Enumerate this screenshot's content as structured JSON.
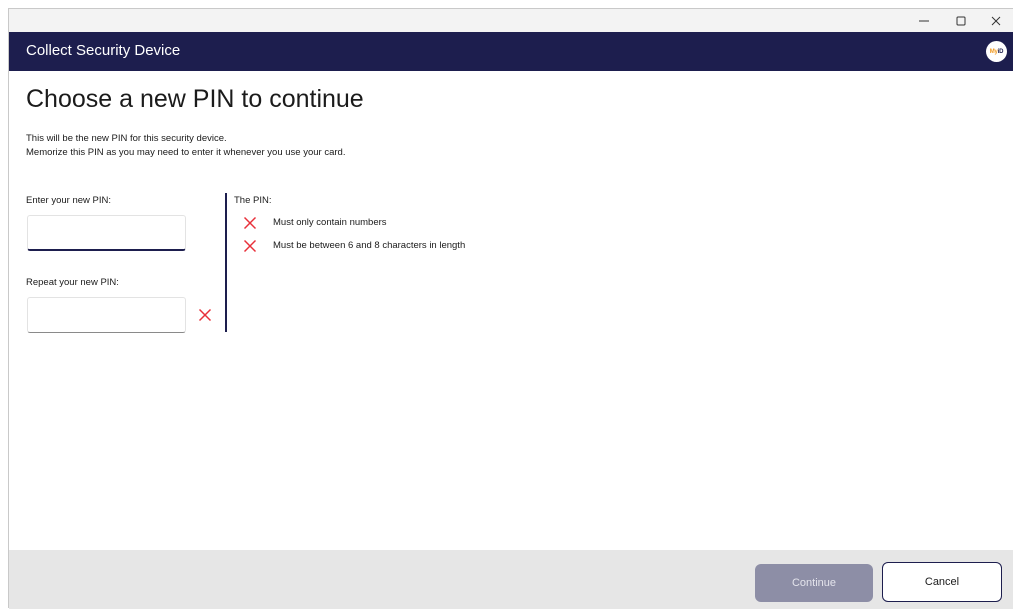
{
  "window": {
    "controls": {
      "minimize": "–",
      "maximize": "☐",
      "close": "✕"
    }
  },
  "header": {
    "title": "Collect Security Device",
    "logo_text_my": "My",
    "logo_text_id": "iD"
  },
  "page": {
    "title": "Choose a new PIN to continue",
    "description_line1": "This will be the new PIN for this security device.",
    "description_line2": "Memorize this PIN as you may need to enter it whenever you use your card."
  },
  "form": {
    "new_pin_label": "Enter your new PIN:",
    "new_pin_value": "",
    "repeat_pin_label": "Repeat your new PIN:",
    "repeat_pin_value": "",
    "repeat_pin_status_icon": "cross-icon"
  },
  "rules": {
    "heading": "The PIN:",
    "items": [
      {
        "text": "Must only contain numbers",
        "status": "fail",
        "icon": "cross-icon"
      },
      {
        "text": "Must be between 6 and 8 characters in length",
        "status": "fail",
        "icon": "cross-icon"
      }
    ]
  },
  "footer": {
    "continue_label": "Continue",
    "continue_enabled": false,
    "cancel_label": "Cancel"
  },
  "colors": {
    "brand_navy": "#1d1e4e",
    "error_red": "#e8303a",
    "logo_orange": "#f29a1f",
    "footer_bg": "#e6e6e6",
    "disabled_button": "#8d8ea6"
  }
}
